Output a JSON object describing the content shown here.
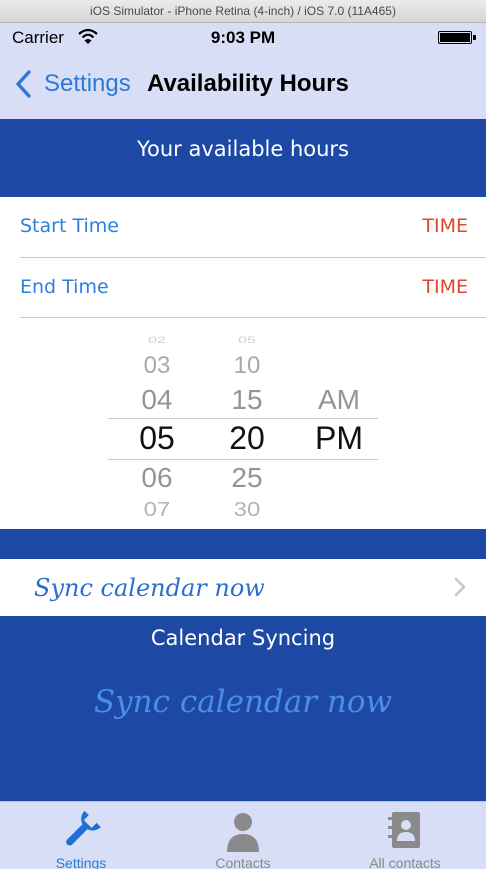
{
  "window": {
    "title": "iOS Simulator - iPhone Retina (4-inch) / iOS 7.0 (11A465)"
  },
  "status_bar": {
    "carrier": "Carrier",
    "time": "9:03 PM"
  },
  "nav": {
    "back_label": "Settings",
    "title": "Availability Hours"
  },
  "header": {
    "title": "Your available hours"
  },
  "rows": [
    {
      "label": "Start Time",
      "value": "TIME"
    },
    {
      "label": "End Time",
      "value": "TIME"
    }
  ],
  "picker": {
    "hours": [
      "02",
      "03",
      "04",
      "05",
      "06",
      "07"
    ],
    "minutes": [
      "05",
      "10",
      "15",
      "20",
      "25",
      "30"
    ],
    "meridiem": [
      "AM",
      "PM"
    ],
    "selected": {
      "hour": "05",
      "minute": "20",
      "meridiem": "PM"
    }
  },
  "sync_row": {
    "label": "Sync calendar now"
  },
  "calendar_section": {
    "title": "Calendar Syncing",
    "button": "Sync calendar now"
  },
  "tabs": [
    {
      "label": "Settings",
      "icon": "wrench-icon",
      "active": true
    },
    {
      "label": "Contacts",
      "icon": "person-icon",
      "active": false
    },
    {
      "label": "All contacts",
      "icon": "address-book-icon",
      "active": false
    }
  ],
  "colors": {
    "nav_background": "#d7def6",
    "section_blue": "#1d49a5",
    "ios_blue": "#2b7bd6",
    "time_red": "#e0452e",
    "tab_inactive": "#8a8a8a"
  }
}
